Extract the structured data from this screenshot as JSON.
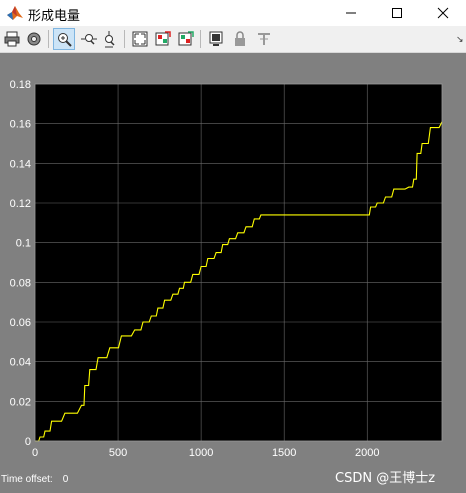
{
  "window": {
    "title": "形成电量",
    "controls": [
      "minimize-icon",
      "maximize-icon",
      "close-icon"
    ]
  },
  "toolbar": {
    "buttons": [
      {
        "name": "print-icon"
      },
      {
        "name": "parameters-gear-icon"
      },
      {
        "name": "zoom-in-icon",
        "active": true
      },
      {
        "name": "zoom-x-icon"
      },
      {
        "name": "zoom-y-icon"
      },
      {
        "name": "autoscale-icon"
      },
      {
        "name": "save-axes-settings-icon"
      },
      {
        "name": "restore-axes-settings-icon"
      },
      {
        "name": "floating-scope-icon"
      },
      {
        "name": "lock-axes-icon"
      },
      {
        "name": "signal-selector-icon"
      }
    ]
  },
  "footer": {
    "time_offset_label": "Time offset:",
    "time_offset_value": "0"
  },
  "watermark": "CSDN @王博士z",
  "chart_data": {
    "type": "line",
    "xlim": [
      0,
      2450
    ],
    "ylim": [
      0,
      0.18
    ],
    "x_ticks": [
      0,
      500,
      1000,
      1500,
      2000
    ],
    "y_ticks": [
      0,
      0.02,
      0.04,
      0.06,
      0.08,
      0.1,
      0.12,
      0.14,
      0.16,
      0.18
    ],
    "x_tick_labels": [
      "0",
      "500",
      "1000",
      "1500",
      "2000"
    ],
    "y_tick_labels": [
      "0",
      "0.02",
      "0.04",
      "0.06",
      "0.08",
      "0.1",
      "0.12",
      "0.14",
      "0.16",
      "0.18"
    ],
    "grid": true,
    "background": "#000000",
    "series": [
      {
        "color": "#ffff00",
        "x": [
          0,
          30,
          60,
          100,
          180,
          280,
          300,
          330,
          380,
          450,
          520,
          600,
          650,
          700,
          740,
          780,
          830,
          870,
          900,
          950,
          1000,
          1040,
          1090,
          1130,
          1170,
          1220,
          1270,
          1320,
          1360,
          1400,
          1700,
          1800,
          1900,
          1990,
          2020,
          2060,
          2110,
          2160,
          2250,
          2280,
          2300,
          2330,
          2380,
          2450
        ],
        "y": [
          0,
          0.002,
          0.005,
          0.01,
          0.014,
          0.018,
          0.028,
          0.036,
          0.042,
          0.047,
          0.053,
          0.056,
          0.06,
          0.063,
          0.067,
          0.071,
          0.074,
          0.077,
          0.08,
          0.084,
          0.088,
          0.092,
          0.095,
          0.099,
          0.102,
          0.105,
          0.108,
          0.112,
          0.114,
          0.114,
          0.114,
          0.114,
          0.114,
          0.114,
          0.118,
          0.12,
          0.123,
          0.127,
          0.128,
          0.132,
          0.145,
          0.15,
          0.158,
          0.161
        ]
      }
    ]
  }
}
